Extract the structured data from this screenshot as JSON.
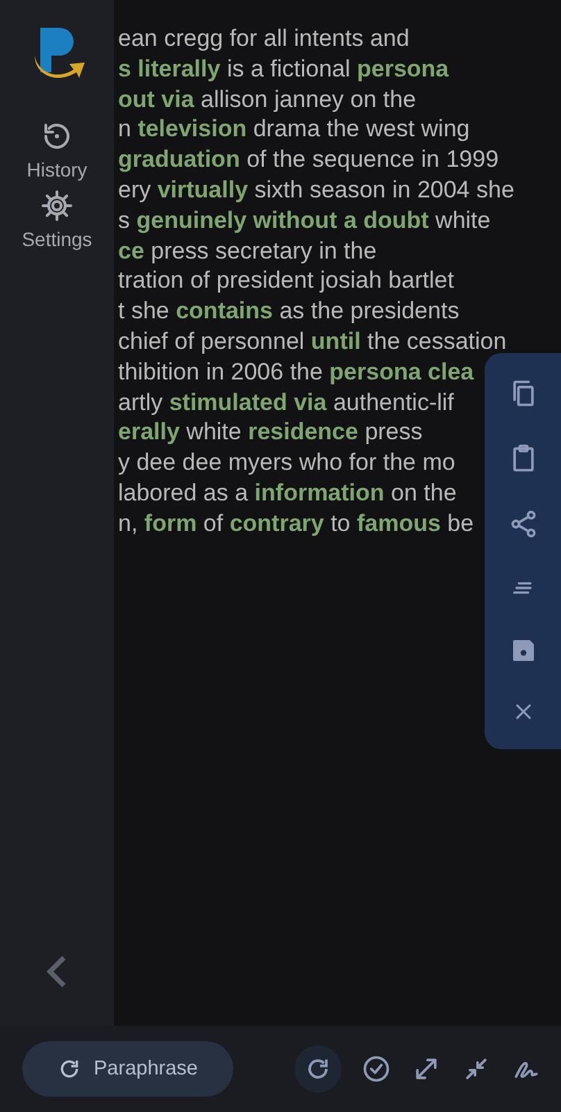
{
  "sidebar": {
    "items": [
      {
        "kind": "history",
        "label": "History"
      },
      {
        "kind": "settings",
        "label": "Settings"
      }
    ]
  },
  "text": {
    "lines": [
      "ean cregg for all intents and",
      "**s literally** is a fictional **persona**",
      "**out via** allison janney on the",
      "n **television** drama the west wing",
      "**graduation** of the sequence in 1999",
      "ery **virtually** sixth season in 2004 she",
      "s **genuinely without a doubt** white",
      "**ce** press secretary in the",
      "tration of president josiah bartlet",
      "t she **contains** as the presidents",
      "chief of personnel **until** the cessation",
      "thibition in 2006 the **persona clea**",
      "artly **stimulated via** authentic-lif",
      "**erally** white **residence** press",
      "y dee dee myers who for the mo",
      "labored as a **information** on the",
      "n, **form** of **contrary** to **famous** be"
    ]
  },
  "footer": {
    "paraphrase_button": "Paraphrase"
  }
}
